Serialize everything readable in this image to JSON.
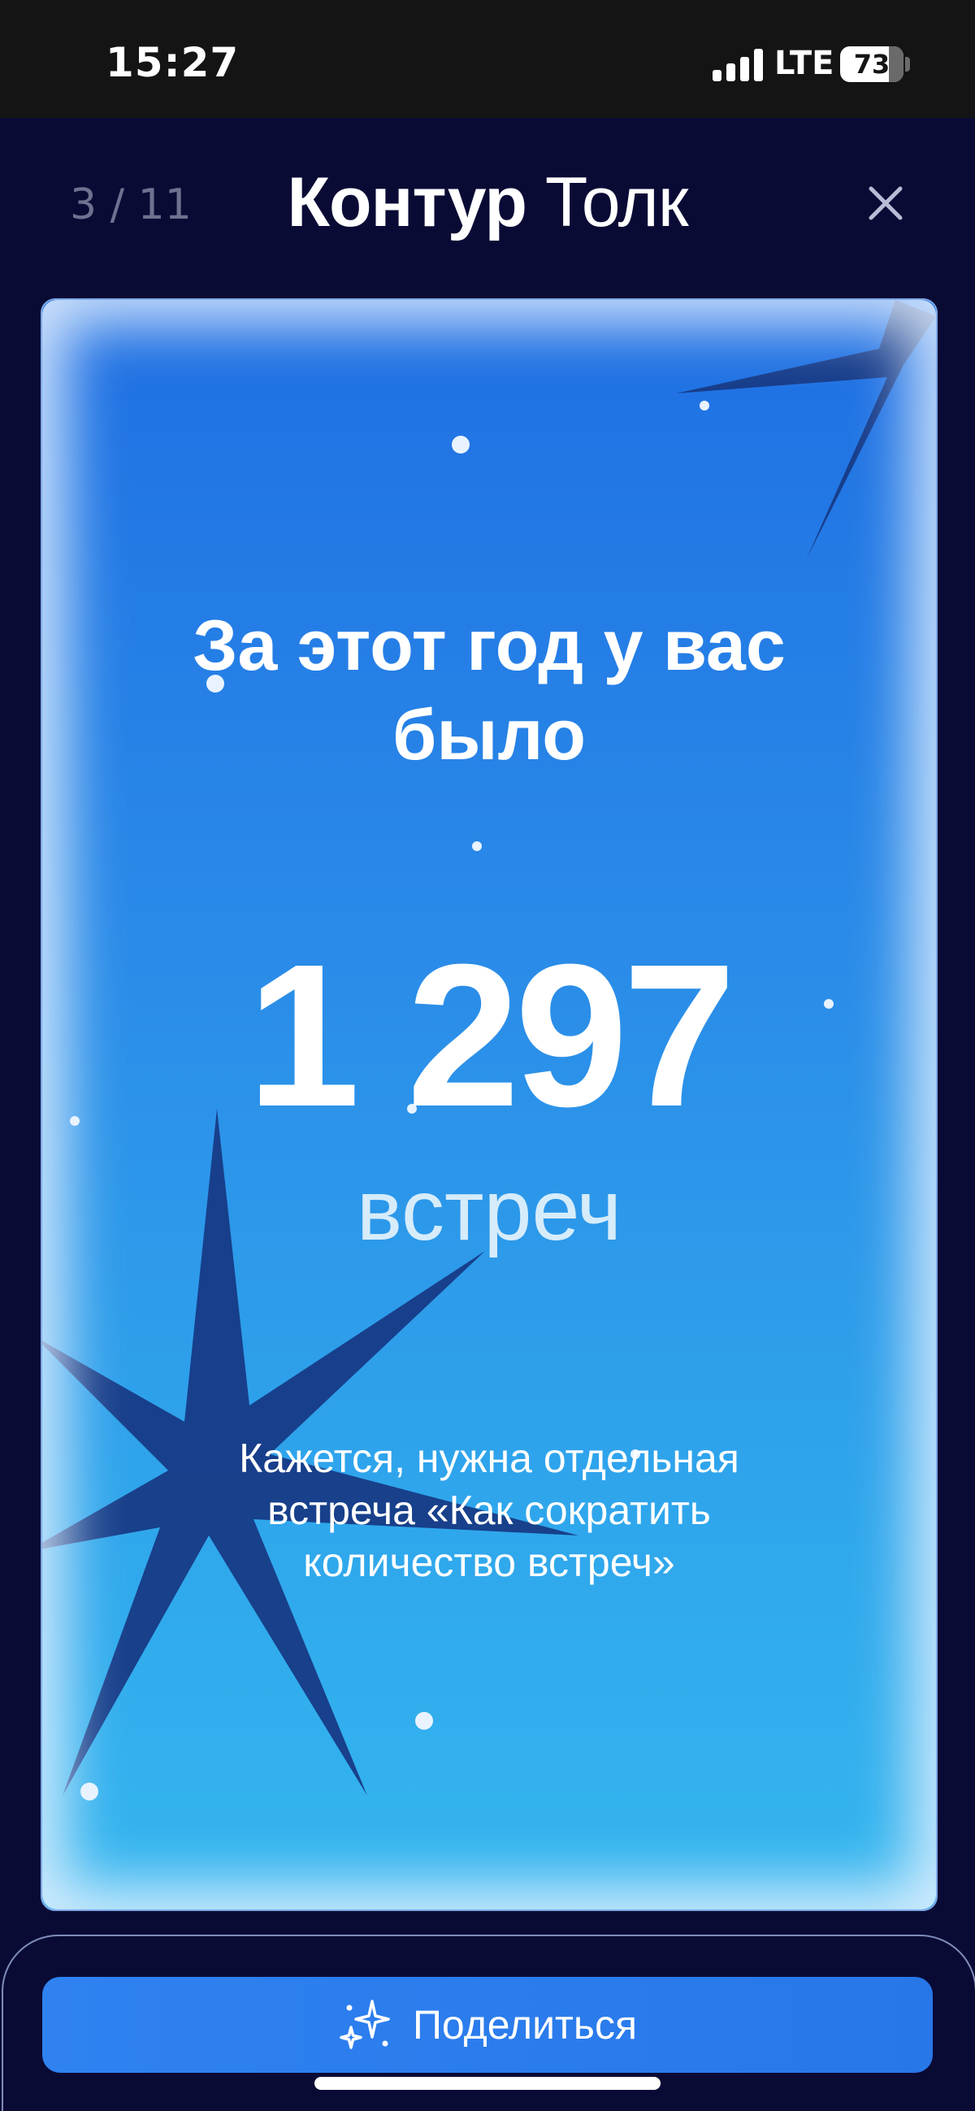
{
  "status_bar": {
    "time": "15:27",
    "network": "LTE",
    "battery": "73"
  },
  "header": {
    "page_counter": "3 / 11",
    "brand_bold": "Контур",
    "brand_light": "Толк",
    "close_icon": "close-icon"
  },
  "card": {
    "heading_line1": "За этот год у вас",
    "heading_line2": "было",
    "number": "1 297",
    "unit": "встреч",
    "caption_line1": "Кажется, нужна отдельная",
    "caption_line2": "встреча «Как сократить",
    "caption_line3": "количество встреч»",
    "colors": {
      "gradient_top": "#1f6fe3",
      "gradient_bottom": "#34b6ef",
      "star": "#173a86"
    }
  },
  "share": {
    "label": "Поделиться",
    "icon": "sparkle-icon"
  }
}
